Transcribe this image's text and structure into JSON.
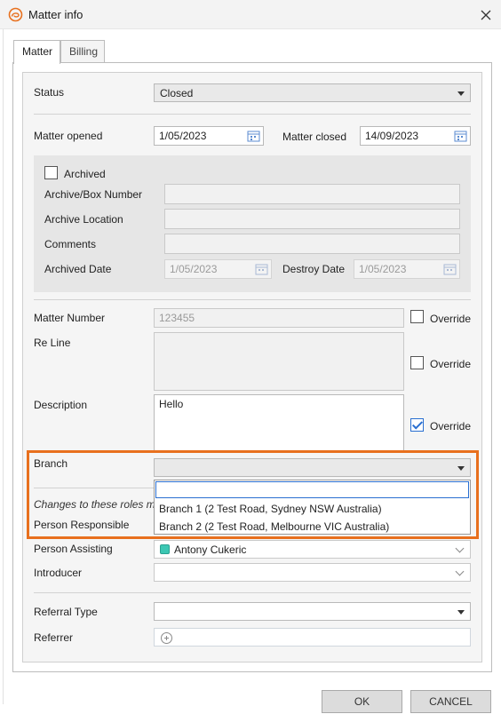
{
  "window": {
    "title": "Matter info",
    "app_icon": "spiral-logo-icon",
    "close_icon": "close-icon"
  },
  "tabs": [
    {
      "label": "Matter",
      "active": true
    },
    {
      "label": "Billing",
      "active": false
    }
  ],
  "status": {
    "label": "Status",
    "value": "Closed"
  },
  "matter_opened": {
    "label": "Matter opened",
    "value": "1/05/2023"
  },
  "matter_closed": {
    "label": "Matter closed",
    "value": "14/09/2023"
  },
  "archive": {
    "archived_label": "Archived",
    "archived_checked": false,
    "box_number_label": "Archive/Box Number",
    "location_label": "Archive Location",
    "comments_label": "Comments",
    "archived_date_label": "Archived Date",
    "archived_date_value": "1/05/2023",
    "destroy_date_label": "Destroy Date",
    "destroy_date_value": "1/05/2023"
  },
  "matter_number": {
    "label": "Matter Number",
    "value": "123455",
    "override_label": "Override",
    "override_checked": false
  },
  "re_line": {
    "label": "Re Line",
    "value": "",
    "override_label": "Override",
    "override_checked": false
  },
  "description": {
    "label": "Description",
    "value": "Hello",
    "override_label": "Override",
    "override_checked": true
  },
  "branch": {
    "label": "Branch",
    "value": "",
    "options": [
      "Branch 1  (2 Test Road, Sydney NSW Australia)",
      "Branch 2 (2 Test Road, Melbourne VIC Australia)"
    ]
  },
  "roles_note": "Changes to these roles ma",
  "person_responsible": {
    "label": "Person Responsible"
  },
  "person_assisting": {
    "label": "Person Assisting",
    "value": "Antony Cukeric",
    "color": "#3cc7b3"
  },
  "introducer": {
    "label": "Introducer",
    "value": ""
  },
  "referral_type": {
    "label": "Referral Type",
    "value": ""
  },
  "referrer": {
    "label": "Referrer"
  },
  "buttons": {
    "ok": "OK",
    "cancel": "CANCEL"
  },
  "colors": {
    "highlight": "#e8701e",
    "accent": "#2a6fd1"
  }
}
